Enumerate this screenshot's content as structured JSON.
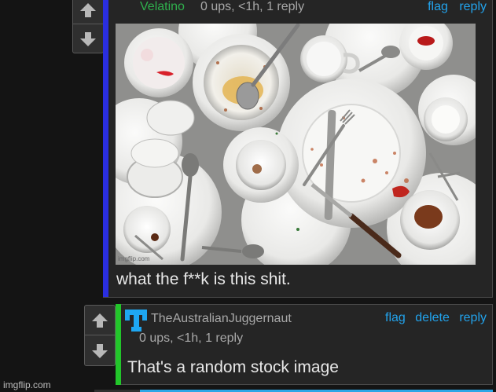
{
  "comment1": {
    "username": "Velatino",
    "meta": "0 ups, <1h, 1 reply",
    "actions": {
      "flag": "flag",
      "reply": "reply"
    },
    "image_watermark": "imgflip.com",
    "text": "what the f**k is this shit.",
    "colors": {
      "username": "#2fb04d",
      "depth_bar": "#2a2ee0",
      "actions": "#22a3ec"
    }
  },
  "comment2": {
    "username": "TheAustralianJuggernaut",
    "meta": "0 ups, <1h, 1 reply",
    "actions": {
      "flag": "flag",
      "delete": "delete",
      "reply": "reply"
    },
    "text": "That's a random stock image",
    "colors": {
      "depth_bar": "#22c52a",
      "avatar": "#1ea7f2"
    }
  },
  "vote_icons": {
    "up": "arrow-up-icon",
    "down": "arrow-down-icon"
  },
  "watermark": "imgflip.com"
}
